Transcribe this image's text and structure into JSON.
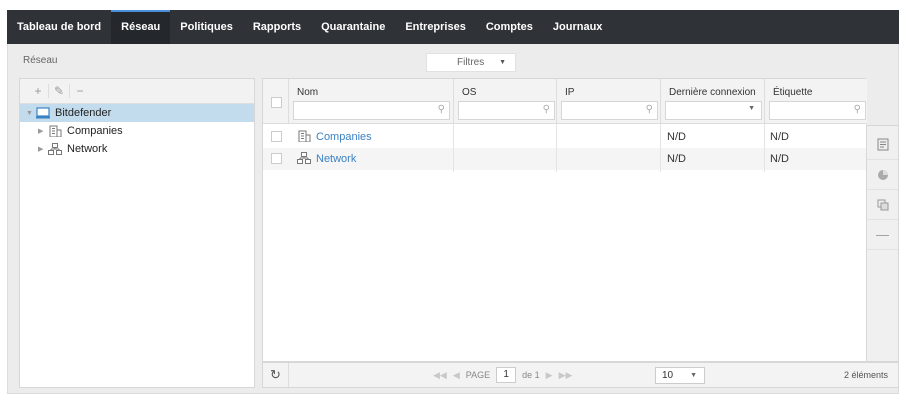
{
  "nav": {
    "tabs": [
      {
        "label": "Tableau de bord"
      },
      {
        "label": "Réseau"
      },
      {
        "label": "Politiques"
      },
      {
        "label": "Rapports"
      },
      {
        "label": "Quarantaine"
      },
      {
        "label": "Entreprises"
      },
      {
        "label": "Comptes"
      },
      {
        "label": "Journaux"
      }
    ],
    "active": "Réseau"
  },
  "breadcrumb": "Réseau",
  "filters": {
    "label": "Filtres"
  },
  "tree": {
    "toolbar": {
      "add": "+",
      "edit": "✎",
      "remove": "−"
    },
    "root": {
      "label": "Bitdefender"
    },
    "children": [
      {
        "label": "Companies",
        "icon": "building-icon"
      },
      {
        "label": "Network",
        "icon": "network-icon"
      }
    ]
  },
  "grid": {
    "columns": [
      {
        "label": "Nom"
      },
      {
        "label": "OS"
      },
      {
        "label": "IP"
      },
      {
        "label": "Dernière connexion"
      },
      {
        "label": "Étiquette"
      }
    ],
    "rows": [
      {
        "name": "Companies",
        "icon": "building-icon",
        "os": "",
        "ip": "",
        "last_seen": "N/D",
        "label": "N/D"
      },
      {
        "name": "Network",
        "icon": "network-icon",
        "os": "",
        "ip": "",
        "last_seen": "N/D",
        "label": "N/D"
      }
    ]
  },
  "pagination": {
    "page_label": "PAGE",
    "page": "1",
    "of_label": "de 1",
    "per_page": "10",
    "count": "2 éléments"
  },
  "colors": {
    "nav_bg": "#2f3237",
    "selected_row": "#c3dced",
    "link": "#3b82c4"
  }
}
